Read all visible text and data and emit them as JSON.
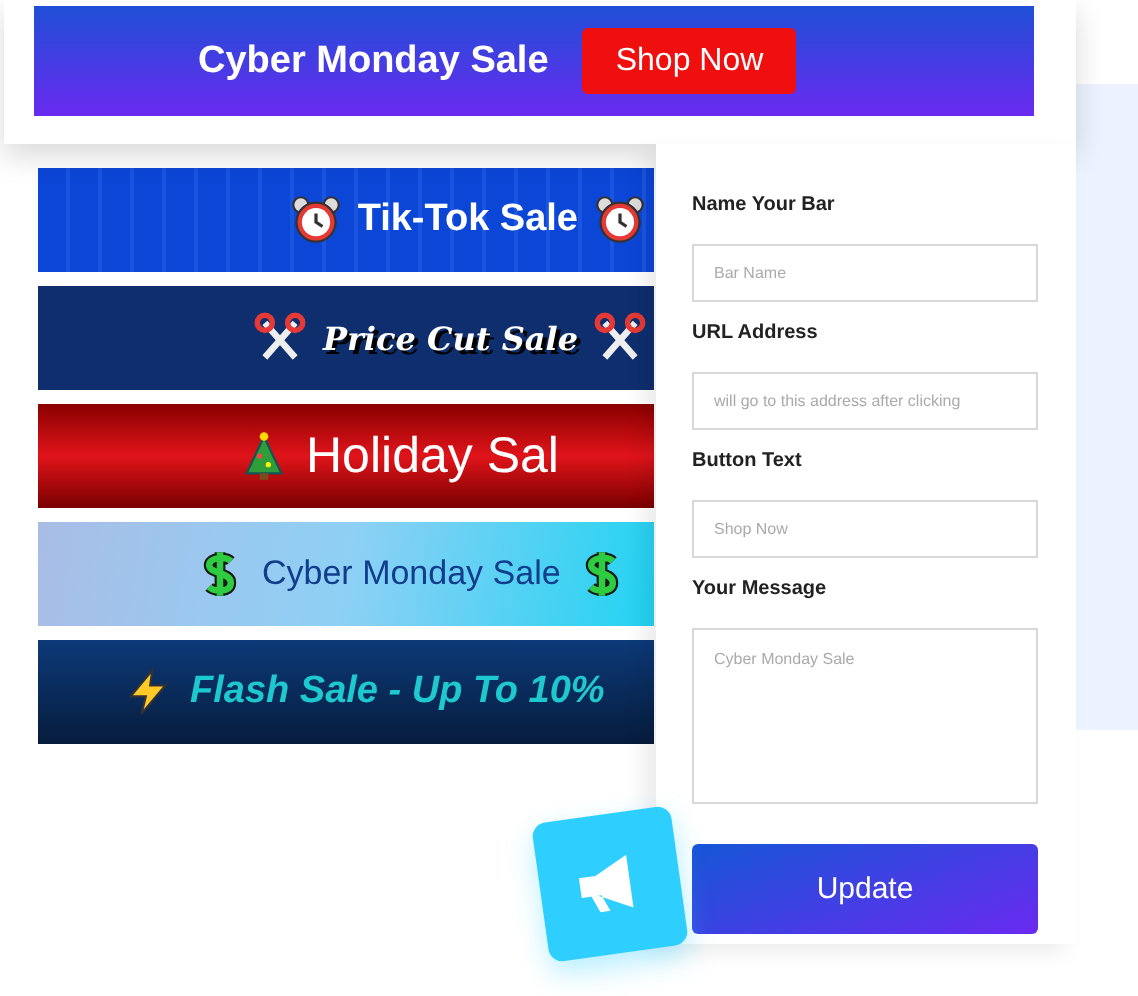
{
  "preview_bar": {
    "message": "Cyber Monday Sale",
    "button": "Shop Now"
  },
  "banners": [
    {
      "kind": "alarm",
      "text": "Tik-Tok Sale",
      "trailing_icon": true
    },
    {
      "kind": "scissors",
      "text": "Price Cut Sale",
      "trailing_icon": true
    },
    {
      "kind": "tree",
      "text": "Holiday Sal",
      "trailing_icon": false
    },
    {
      "kind": "dollar",
      "text": "Cyber Monday Sale",
      "trailing_icon": true
    },
    {
      "kind": "bolt",
      "text": "Flash Sale - Up To 10%",
      "trailing_icon": false
    }
  ],
  "form": {
    "fields": [
      {
        "kind": "input",
        "label": "Name Your Bar",
        "placeholder": "Bar Name"
      },
      {
        "kind": "input",
        "label": "URL Address",
        "placeholder": "will go to this address after clicking"
      },
      {
        "kind": "input",
        "label": "Button Text",
        "placeholder": "Shop Now"
      },
      {
        "kind": "textarea",
        "label": "Your Message",
        "placeholder": "Cyber Monday Sale"
      }
    ],
    "button": "Update"
  }
}
